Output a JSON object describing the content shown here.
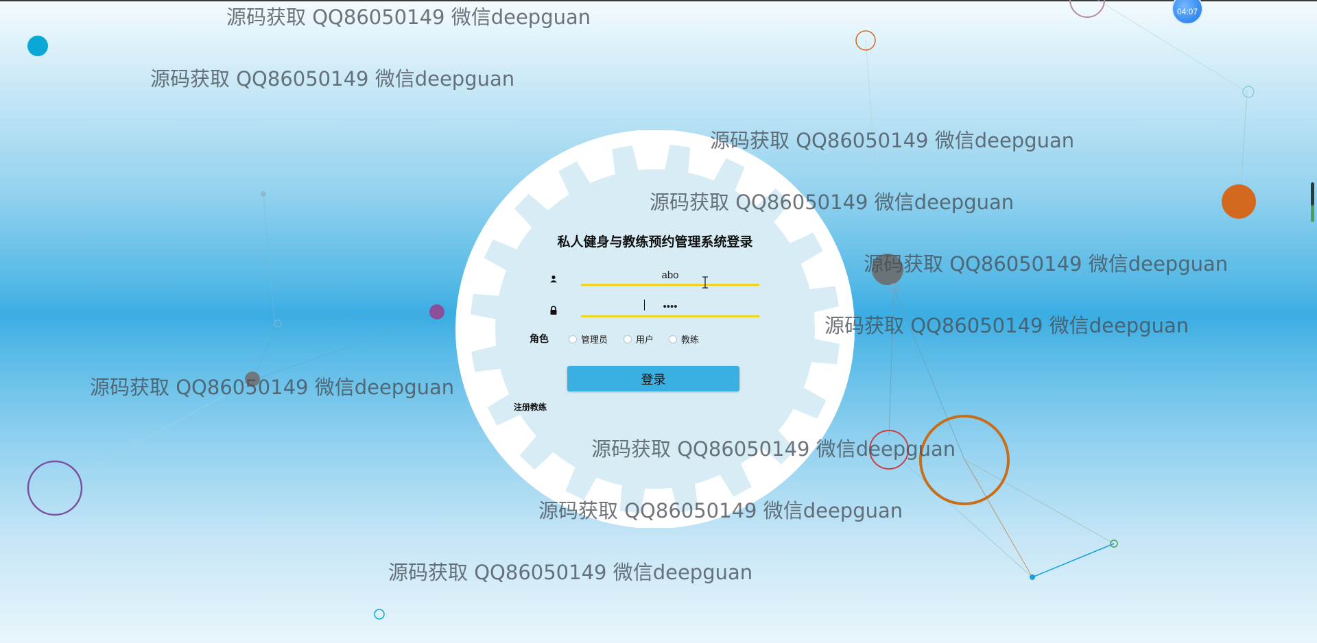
{
  "login": {
    "title": "私人健身与教练预约管理系统登录",
    "username_value": "abo",
    "password_value": "••••",
    "role_label": "角色",
    "roles": [
      "管理员",
      "用户",
      "教练"
    ],
    "login_button": "登录",
    "register_link": "注册教练"
  },
  "time_badge": "04:07",
  "watermark_text": "源码获取 QQ86050149 微信deepguan",
  "colors": {
    "accent_blue": "#3ab0e2",
    "input_underline": "#f0d51e",
    "panel": "#d7ecf5"
  }
}
